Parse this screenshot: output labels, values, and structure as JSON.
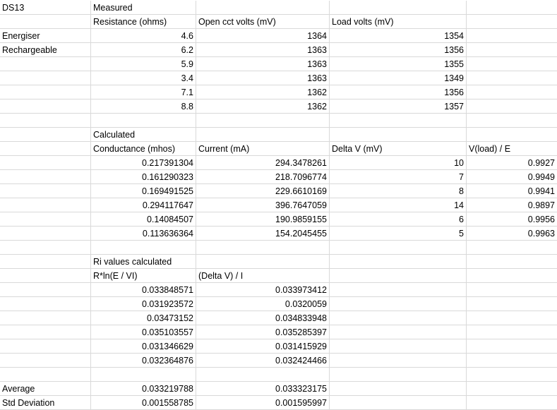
{
  "sheet_title": "DS13",
  "labels": {
    "energiser": "Energiser",
    "rechargeable": "Rechargeable",
    "average": "Average",
    "std_deviation": "Std Deviation"
  },
  "measured": {
    "section_title": "Measured",
    "headers": [
      "Resistance (ohms)",
      "Open cct volts (mV)",
      "Load volts (mV)"
    ],
    "rows": [
      [
        "4.6",
        "1364",
        "1354"
      ],
      [
        "6.2",
        "1363",
        "1356"
      ],
      [
        "5.9",
        "1363",
        "1355"
      ],
      [
        "3.4",
        "1363",
        "1349"
      ],
      [
        "7.1",
        "1362",
        "1356"
      ],
      [
        "8.8",
        "1362",
        "1357"
      ]
    ]
  },
  "calculated": {
    "section_title": "Calculated",
    "headers": [
      "Conductance (mhos)",
      "Current (mA)",
      "Delta V (mV)",
      "V(load) / E"
    ],
    "rows": [
      [
        "0.217391304",
        "294.3478261",
        "10",
        "0.9927"
      ],
      [
        "0.161290323",
        "218.7096774",
        "7",
        "0.9949"
      ],
      [
        "0.169491525",
        "229.6610169",
        "8",
        "0.9941"
      ],
      [
        "0.294117647",
        "396.7647059",
        "14",
        "0.9897"
      ],
      [
        "0.14084507",
        "190.9859155",
        "6",
        "0.9956"
      ],
      [
        "0.113636364",
        "154.2045455",
        "5",
        "0.9963"
      ]
    ]
  },
  "ri": {
    "section_title": "Ri values calculated",
    "headers": [
      "R*ln(E / VI)",
      "(Delta V) / I"
    ],
    "rows": [
      [
        "0.033848571",
        "0.033973412"
      ],
      [
        "0.031923572",
        "0.0320059"
      ],
      [
        "0.03473152",
        "0.034833948"
      ],
      [
        "0.035103557",
        "0.035285397"
      ],
      [
        "0.031346629",
        "0.031415929"
      ],
      [
        "0.032364876",
        "0.032424466"
      ]
    ],
    "average": [
      "0.033219788",
      "0.033323175"
    ],
    "std_deviation": [
      "0.001558785",
      "0.001595997"
    ]
  }
}
